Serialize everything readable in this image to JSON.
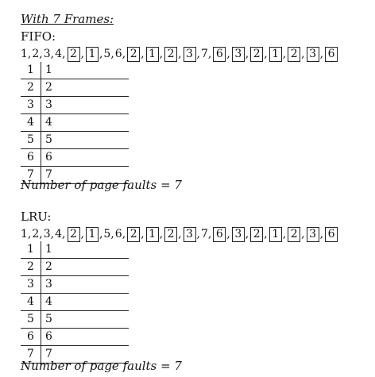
{
  "heading": "With 7 Frames:",
  "sections": [
    {
      "title": "FIFO:",
      "reference_string": [
        {
          "value": "1",
          "boxed": false
        },
        {
          "value": "2",
          "boxed": false
        },
        {
          "value": "3",
          "boxed": false
        },
        {
          "value": "4",
          "boxed": false
        },
        {
          "value": "2",
          "boxed": true
        },
        {
          "value": "1",
          "boxed": true
        },
        {
          "value": "5",
          "boxed": false
        },
        {
          "value": "6",
          "boxed": false
        },
        {
          "value": "2",
          "boxed": true
        },
        {
          "value": "1",
          "boxed": true
        },
        {
          "value": "2",
          "boxed": true
        },
        {
          "value": "3",
          "boxed": true
        },
        {
          "value": "7",
          "boxed": false
        },
        {
          "value": "6",
          "boxed": true
        },
        {
          "value": "3",
          "boxed": true
        },
        {
          "value": "2",
          "boxed": true
        },
        {
          "value": "1",
          "boxed": true
        },
        {
          "value": "2",
          "boxed": true
        },
        {
          "value": "3",
          "boxed": true
        },
        {
          "value": "6",
          "boxed": true
        }
      ],
      "frames": [
        {
          "index": "1",
          "value": "1"
        },
        {
          "index": "2",
          "value": "2"
        },
        {
          "index": "3",
          "value": "3"
        },
        {
          "index": "4",
          "value": "4"
        },
        {
          "index": "5",
          "value": "5"
        },
        {
          "index": "6",
          "value": "6"
        },
        {
          "index": "7",
          "value": "7"
        }
      ],
      "faults_label": "Number of page faults = 7"
    },
    {
      "title": "LRU:",
      "reference_string": [
        {
          "value": "1",
          "boxed": false
        },
        {
          "value": "2",
          "boxed": false
        },
        {
          "value": "3",
          "boxed": false
        },
        {
          "value": "4",
          "boxed": false
        },
        {
          "value": "2",
          "boxed": true
        },
        {
          "value": "1",
          "boxed": true
        },
        {
          "value": "5",
          "boxed": false
        },
        {
          "value": "6",
          "boxed": false
        },
        {
          "value": "2",
          "boxed": true
        },
        {
          "value": "1",
          "boxed": true
        },
        {
          "value": "2",
          "boxed": true
        },
        {
          "value": "3",
          "boxed": true
        },
        {
          "value": "7",
          "boxed": false
        },
        {
          "value": "6",
          "boxed": true
        },
        {
          "value": "3",
          "boxed": true
        },
        {
          "value": "2",
          "boxed": true
        },
        {
          "value": "1",
          "boxed": true
        },
        {
          "value": "2",
          "boxed": true
        },
        {
          "value": "3",
          "boxed": true
        },
        {
          "value": "6",
          "boxed": true
        }
      ],
      "frames": [
        {
          "index": "1",
          "value": "1"
        },
        {
          "index": "2",
          "value": "2"
        },
        {
          "index": "3",
          "value": "3"
        },
        {
          "index": "4",
          "value": "4"
        },
        {
          "index": "5",
          "value": "5"
        },
        {
          "index": "6",
          "value": "6"
        },
        {
          "index": "7",
          "value": "7"
        }
      ],
      "faults_label": "Number of page faults = 7"
    }
  ]
}
